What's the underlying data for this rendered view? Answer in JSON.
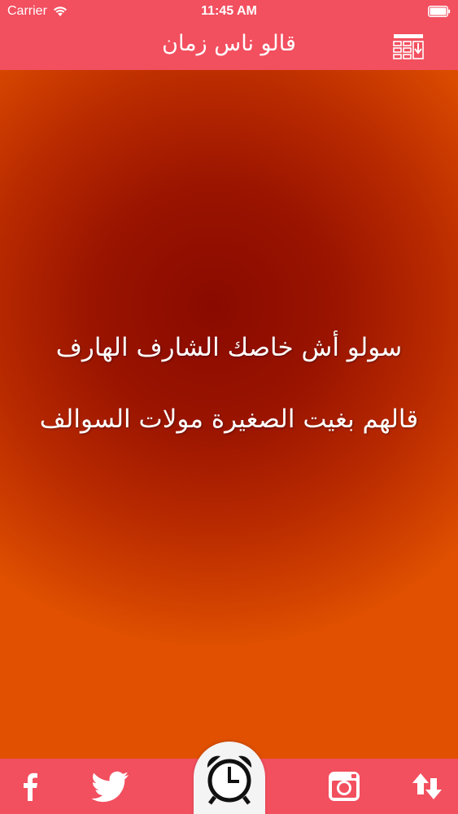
{
  "status_bar": {
    "carrier": "Carrier",
    "time": "11:45 AM"
  },
  "nav": {
    "title": "قالو ناس زمان",
    "right_icon": "grid-download-icon"
  },
  "quote": {
    "line1": "سولو أش خاصك الشارف الهارف",
    "line2": "قالهم بغيت الصغيرة مولات السوالف"
  },
  "tabbar": {
    "items": [
      {
        "icon": "facebook-icon"
      },
      {
        "icon": "twitter-icon"
      },
      {
        "icon": "alarm-clock-icon"
      },
      {
        "icon": "instagram-icon"
      },
      {
        "icon": "shuffle-arrows-icon"
      }
    ]
  },
  "colors": {
    "header": "#f24f5f",
    "background_center": "#8a0a00",
    "background_edge": "#e05000",
    "text": "#ffffff"
  }
}
